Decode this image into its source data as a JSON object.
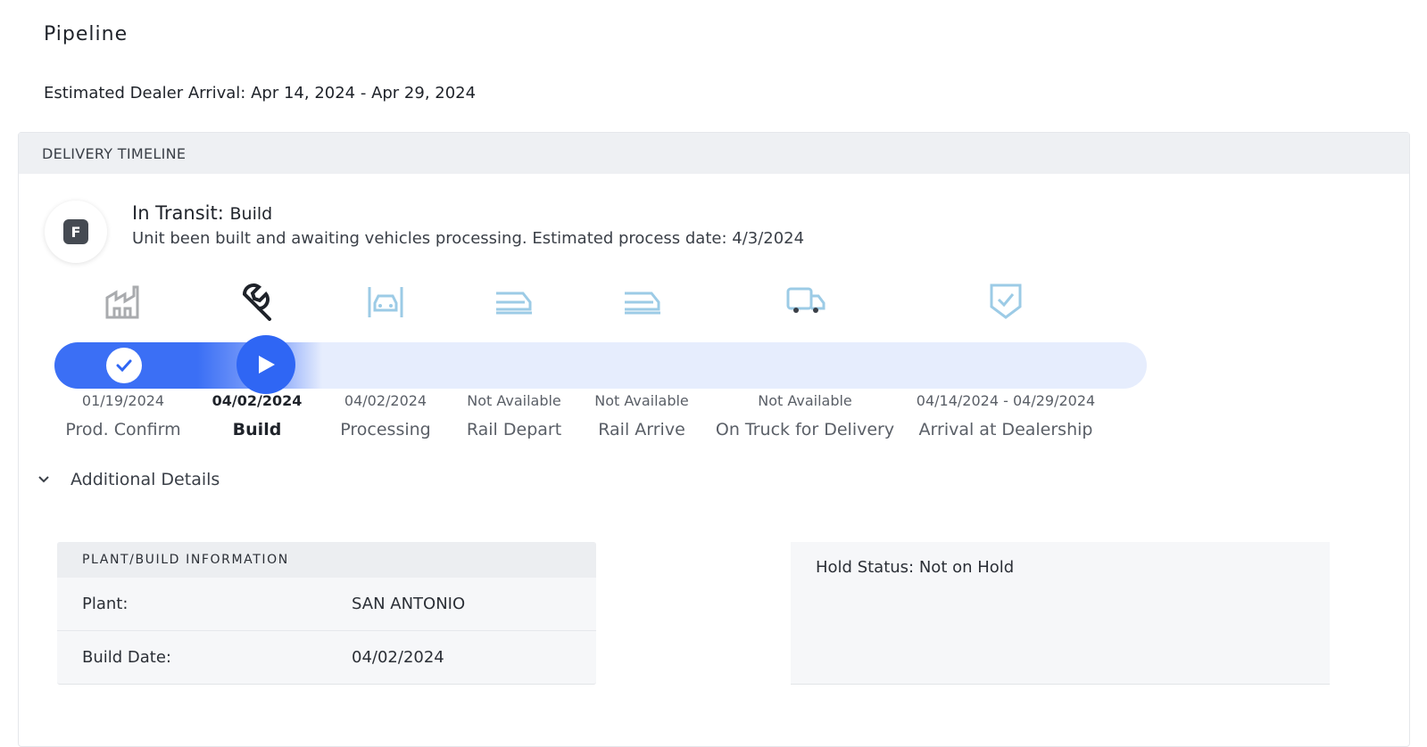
{
  "page": {
    "title": "Pipeline",
    "arrival_label": "Estimated Dealer Arrival:",
    "arrival_range": "Apr 14, 2024 - Apr 29, 2024"
  },
  "timeline": {
    "header": "DELIVERY TIMELINE",
    "status_badge": "F",
    "status_prefix": "In Transit:",
    "status_stage": "Build",
    "status_description": "Unit been built and awaiting vehicles processing. Estimated process date: 4/3/2024",
    "progress_fraction": 0.19,
    "colors": {
      "active": "#2f66f4",
      "track_inactive": "#e6edfd",
      "icon_pending": "#9ccbe6",
      "icon_done": "#a9abae"
    },
    "steps": [
      {
        "label": "Prod. Confirm",
        "date": "01/19/2024",
        "icon": "factory-icon",
        "state": "done"
      },
      {
        "label": "Build",
        "date": "04/02/2024",
        "icon": "wrench-icon",
        "state": "current"
      },
      {
        "label": "Processing",
        "date": "04/02/2024",
        "icon": "car-processing-icon",
        "state": "pending"
      },
      {
        "label": "Rail Depart",
        "date": "Not Available",
        "icon": "train-icon",
        "state": "pending"
      },
      {
        "label": "Rail Arrive",
        "date": "Not Available",
        "icon": "train-icon",
        "state": "pending"
      },
      {
        "label": "On Truck for Delivery",
        "date": "Not Available",
        "icon": "truck-icon",
        "state": "pending"
      },
      {
        "label": "Arrival at Dealership",
        "date": "04/14/2024 - 04/29/2024",
        "icon": "shield-check-icon",
        "state": "pending"
      }
    ]
  },
  "details": {
    "toggle_label": "Additional Details",
    "plant_header": "PLANT/BUILD INFORMATION",
    "plant_label": "Plant:",
    "plant_value": "SAN ANTONIO",
    "build_date_label": "Build Date:",
    "build_date_value": "04/02/2024",
    "hold_status": "Hold Status: Not on Hold"
  }
}
